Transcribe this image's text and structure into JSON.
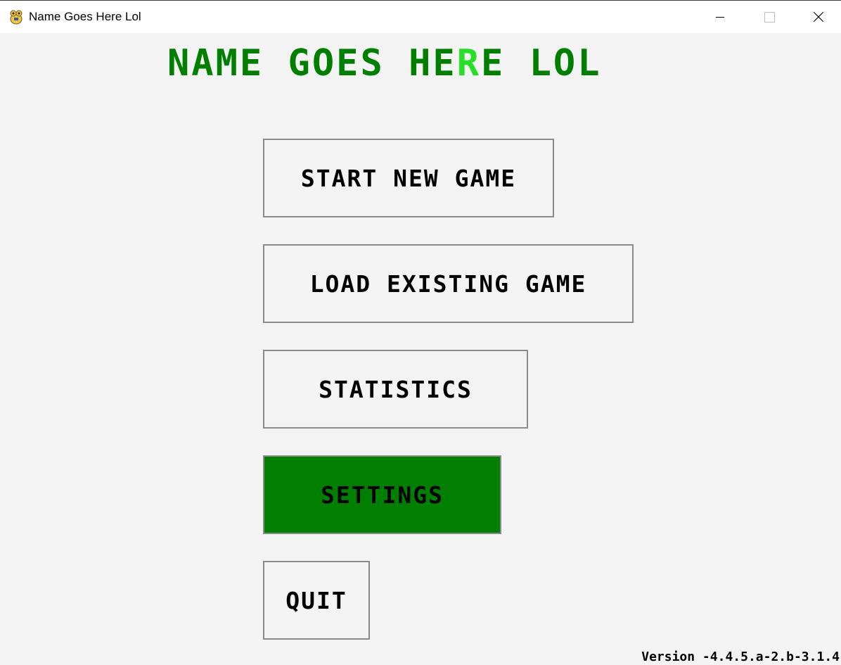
{
  "window": {
    "title": "Name Goes Here Lol",
    "icon": "pygame-snake-icon",
    "controls": [
      "minimize-icon",
      "maximize-icon",
      "close-icon"
    ]
  },
  "game": {
    "title_part1": "NAME GOES HE",
    "title_highlight": "R",
    "title_part2": "E LOL",
    "title_color": "#007f00",
    "title_highlight_color": "#25e025"
  },
  "menu": {
    "start": "START NEW GAME",
    "load": "LOAD EXISTING GAME",
    "statistics": "STATISTICS",
    "settings": "SETTINGS",
    "quit": "QUIT",
    "active_item": "settings",
    "active_color": "#007f00"
  },
  "footer": {
    "version": "Version -4.4.5.a-2.b-3.1.4"
  }
}
